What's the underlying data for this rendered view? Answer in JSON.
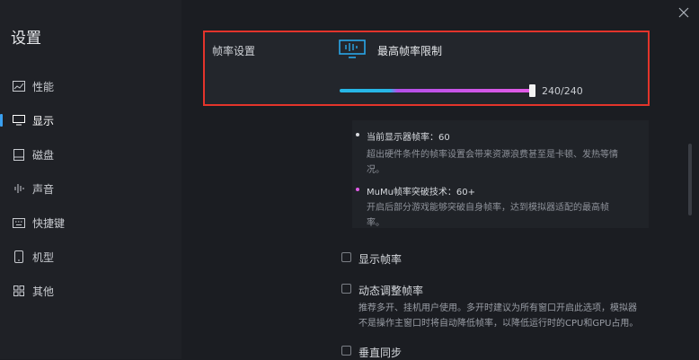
{
  "sidebar": {
    "title": "设置",
    "items": [
      {
        "label": "性能",
        "icon": "performance-icon"
      },
      {
        "label": "显示",
        "icon": "display-icon",
        "active": true
      },
      {
        "label": "磁盘",
        "icon": "disk-icon"
      },
      {
        "label": "声音",
        "icon": "sound-icon"
      },
      {
        "label": "快捷键",
        "icon": "keyboard-icon"
      },
      {
        "label": "机型",
        "icon": "phone-icon"
      },
      {
        "label": "其他",
        "icon": "grid-icon"
      }
    ]
  },
  "framerate": {
    "section_label": "帧率设置",
    "title": "最高帧率限制",
    "value_text": "240/240",
    "value": 240,
    "max": 240
  },
  "info": {
    "line1_title": "当前显示器帧率：60",
    "line1_desc_a": "超出硬件条件的帧率设置会带来资源浪费甚至是卡顿、发热等情",
    "line1_desc_b": "况。",
    "line2_title": "MuMu帧率突破技术：60+",
    "line2_desc_a": "开启后部分游戏能够突破自身帧率，达到模拟器适配的最高帧",
    "line2_desc_b": "率。"
  },
  "options": {
    "show_fps": "显示帧率",
    "dynamic_fps": "动态调整帧率",
    "dynamic_desc_a": "推荐多开、挂机用户使用。多开时建议为所有窗口开启此选项，模拟器",
    "dynamic_desc_b": "不是操作主窗口时将自动降低帧率，以降低运行时的CPU和GPU占用。",
    "vsync": "垂直同步"
  },
  "colors": {
    "accent": "#3aa0f0",
    "highlight_border": "#e3342b",
    "bullet_white": "#d8dade",
    "bullet_pink": "#e05be6"
  }
}
